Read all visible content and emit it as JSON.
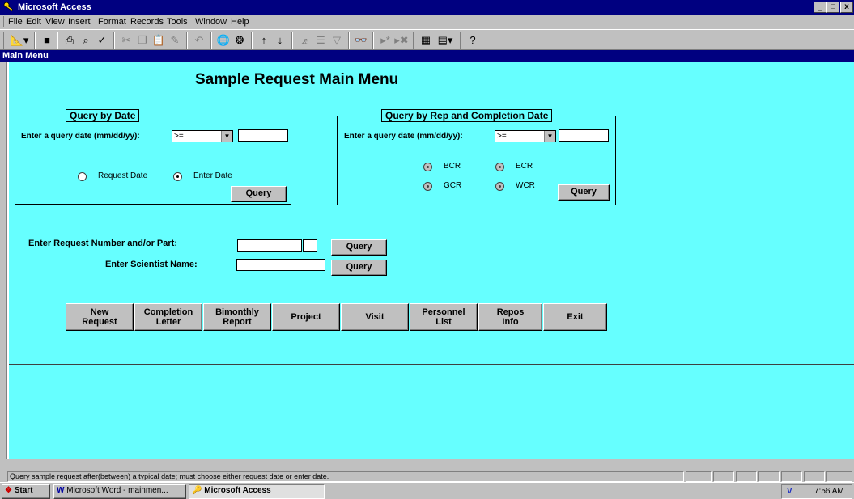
{
  "app": {
    "title": "Microsoft Access",
    "window_controls": [
      "_",
      "□",
      "x"
    ]
  },
  "menu": [
    "File",
    "Edit",
    "View",
    "Insert",
    "Format",
    "Records",
    "Tools",
    "Window",
    "Help"
  ],
  "form": {
    "window_title": "Main Menu",
    "heading": "Sample Request Main Menu",
    "query_by_date": {
      "caption": "Query by Date",
      "date_label": "Enter a query date (mm/dd/yy):",
      "operator": ">=",
      "date_value": "",
      "radio_request": "Request Date",
      "radio_enter": "Enter Date",
      "selected": "Enter Date",
      "button": "Query"
    },
    "query_by_rep": {
      "caption": "Query by Rep and Completion Date",
      "date_label": "Enter a query date (mm/dd/yy):",
      "operator": ">=",
      "date_value": "",
      "options": [
        "BCR",
        "ECR",
        "GCR",
        "WCR"
      ],
      "button": "Query"
    },
    "request_label": "Enter Request Number and/or Part:",
    "request_button": "Query",
    "scientist_label": "Enter Scientist Name:",
    "scientist_button": "Query",
    "nav_buttons": [
      "New\nRequest",
      "Completion\nLetter",
      "Bimonthly\nReport",
      "Project",
      "Visit",
      "Personnel\nList",
      "Repos\nInfo",
      "Exit"
    ]
  },
  "status": {
    "message": "Query sample request after(between) a typical date; must choose either request date or enter date."
  },
  "taskbar": {
    "start": "Start",
    "tasks": [
      "Microsoft Word - mainmen...",
      "Microsoft Access"
    ],
    "clock": "7:56 AM"
  }
}
